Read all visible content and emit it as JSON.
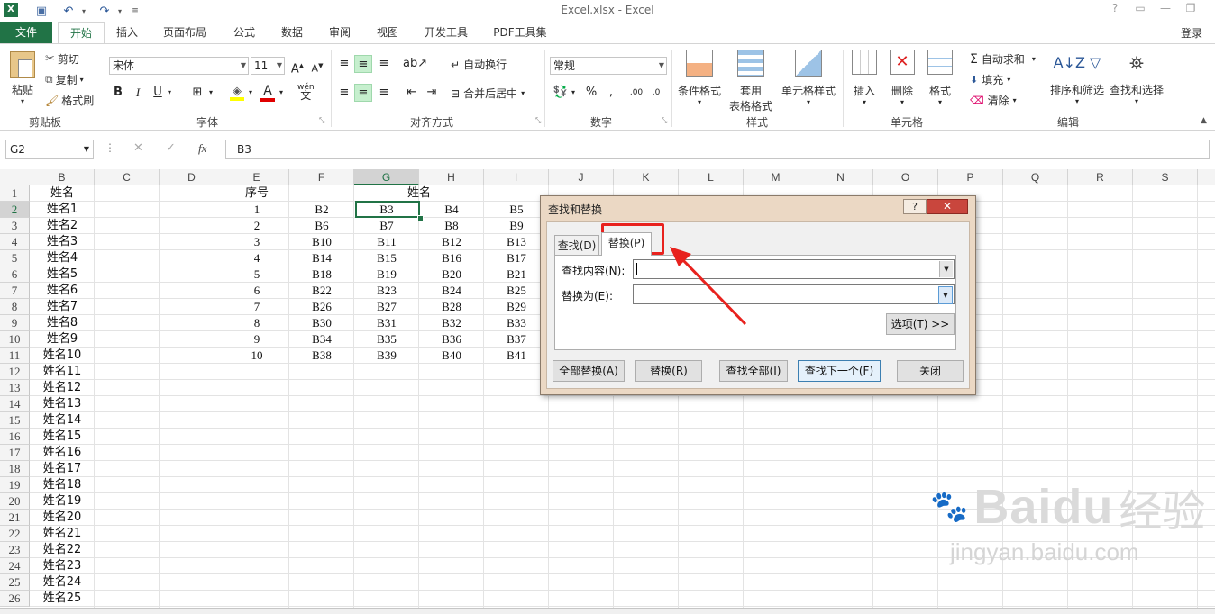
{
  "app": {
    "title": "Excel.xlsx - Excel",
    "user": "登录"
  },
  "tabs": [
    {
      "label": "文件"
    },
    {
      "label": "开始"
    },
    {
      "label": "插入"
    },
    {
      "label": "页面布局"
    },
    {
      "label": "公式"
    },
    {
      "label": "数据"
    },
    {
      "label": "审阅"
    },
    {
      "label": "视图"
    },
    {
      "label": "开发工具"
    },
    {
      "label": "PDF工具集"
    }
  ],
  "ribbon": {
    "clipboard": {
      "paste": "粘贴",
      "cut": "剪切",
      "copy": "复制",
      "format_painter": "格式刷",
      "label": "剪贴板"
    },
    "font": {
      "name": "宋体",
      "size": "11",
      "label": "字体",
      "fill_color": "#ffff00",
      "font_color": "#e00000"
    },
    "alignment": {
      "wrap": "自动换行",
      "merge": "合并后居中",
      "label": "对齐方式"
    },
    "number": {
      "format": "常规",
      "label": "数字"
    },
    "styles": {
      "conditional": "条件格式",
      "table_format_1": "套用",
      "table_format_2": "表格格式",
      "cell_styles": "单元格样式",
      "label": "样式"
    },
    "cells": {
      "insert": "插入",
      "delete": "删除",
      "format": "格式",
      "label": "单元格"
    },
    "editing": {
      "autosum": "自动求和",
      "fill": "填充",
      "clear": "清除",
      "sort_filter": "排序和筛选",
      "find_select": "查找和选择",
      "label": "编辑"
    }
  },
  "formula_bar": {
    "name_box": "G2",
    "content": "B3"
  },
  "columns": [
    "B",
    "C",
    "D",
    "E",
    "F",
    "G",
    "H",
    "I",
    "J",
    "K",
    "L",
    "M",
    "N",
    "O",
    "P",
    "Q",
    "R",
    "S"
  ],
  "rows": [
    "1",
    "2",
    "3",
    "4",
    "5",
    "6",
    "7",
    "8",
    "9",
    "10",
    "11",
    "12",
    "13",
    "14",
    "15",
    "16",
    "17",
    "18",
    "19",
    "20",
    "21",
    "22",
    "23",
    "24",
    "25",
    "26"
  ],
  "cells": {
    "B": [
      "姓名",
      "姓名1",
      "姓名2",
      "姓名3",
      "姓名4",
      "姓名5",
      "姓名6",
      "姓名7",
      "姓名8",
      "姓名9",
      "姓名10",
      "姓名11",
      "姓名12",
      "姓名13",
      "姓名14",
      "姓名15",
      "姓名16",
      "姓名17",
      "姓名18",
      "姓名19",
      "姓名20",
      "姓名21",
      "姓名22",
      "姓名23",
      "姓名24",
      "姓名25"
    ],
    "E": [
      "序号",
      "1",
      "2",
      "3",
      "4",
      "5",
      "6",
      "7",
      "8",
      "9",
      "10"
    ],
    "F": [
      "",
      "B2",
      "B6",
      "B10",
      "B14",
      "B18",
      "B22",
      "B26",
      "B30",
      "B34",
      "B38"
    ],
    "G": [
      "姓名",
      "B3",
      "B7",
      "B11",
      "B15",
      "B19",
      "B23",
      "B27",
      "B31",
      "B35",
      "B39"
    ],
    "H": [
      "",
      "B4",
      "B8",
      "B12",
      "B16",
      "B20",
      "B24",
      "B28",
      "B32",
      "B36",
      "B40"
    ],
    "I": [
      "",
      "B5",
      "B9",
      "B13",
      "B17",
      "B21",
      "B25",
      "B29",
      "B33",
      "B37",
      "B41"
    ]
  },
  "dialog": {
    "title": "查找和替换",
    "help": "?",
    "close": "✕",
    "tab_find": "查找(D)",
    "tab_replace": "替换(P)",
    "find_label": "查找内容(N):",
    "find_value": "",
    "replace_label": "替换为(E):",
    "replace_value": "",
    "options": "选项(T) >>",
    "replace_all": "全部替换(A)",
    "replace": "替换(R)",
    "find_all": "查找全部(I)",
    "find_next": "查找下一个(F)",
    "close_button": "关闭"
  },
  "watermark": {
    "brand": "Baidu",
    "cn": "经验",
    "url": "jingyan.baidu.com"
  },
  "colors": {
    "excel_green": "#217346",
    "annotation_red": "#e8221e"
  }
}
